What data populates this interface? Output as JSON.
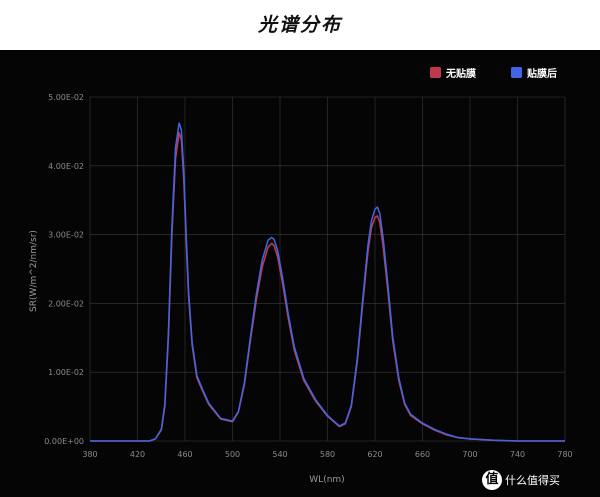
{
  "title": "光谱分布",
  "watermark": {
    "logo_glyph": "值",
    "text": "什么值得买"
  },
  "chart_data": {
    "type": "line",
    "xlabel": "WL(nm)",
    "ylabel": "SR(W/m^2/nm/sr)",
    "xlim": [
      380,
      780
    ],
    "ylim": [
      0,
      0.05
    ],
    "xticks": [
      380,
      420,
      460,
      500,
      540,
      580,
      620,
      660,
      700,
      740,
      780
    ],
    "yticks": [
      0,
      0.01,
      0.02,
      0.03,
      0.04,
      0.05
    ],
    "ytick_labels": [
      "0.00E+00",
      "1.00E-02",
      "2.00E-02",
      "3.00E-02",
      "4.00E-02",
      "5.00E-02"
    ],
    "grid": true,
    "legend_position": "top-right",
    "series": [
      {
        "name": "无贴膜",
        "color": "#c0394a",
        "x": [
          380,
          430,
          435,
          440,
          443,
          446,
          449,
          452,
          455,
          457,
          459,
          461,
          463,
          466,
          470,
          475,
          480,
          490,
          500,
          505,
          510,
          515,
          520,
          525,
          530,
          533,
          535,
          538,
          542,
          547,
          552,
          560,
          570,
          580,
          590,
          595,
          600,
          605,
          610,
          614,
          617,
          620,
          622,
          624,
          627,
          631,
          635,
          640,
          645,
          650,
          660,
          670,
          680,
          690,
          700,
          720,
          740,
          760,
          780
        ],
        "y": [
          0,
          0,
          0.0003,
          0.0016,
          0.005,
          0.015,
          0.03,
          0.041,
          0.0448,
          0.0438,
          0.038,
          0.029,
          0.021,
          0.014,
          0.0092,
          0.0072,
          0.0053,
          0.0032,
          0.0028,
          0.0042,
          0.0082,
          0.0145,
          0.0205,
          0.0253,
          0.0282,
          0.0287,
          0.0284,
          0.0268,
          0.0231,
          0.0178,
          0.0132,
          0.0088,
          0.0058,
          0.0036,
          0.0021,
          0.0025,
          0.005,
          0.0115,
          0.0205,
          0.0275,
          0.031,
          0.0325,
          0.0327,
          0.0318,
          0.0281,
          0.0215,
          0.0145,
          0.0088,
          0.0053,
          0.0037,
          0.0025,
          0.0016,
          0.0009,
          0.0005,
          0.0003,
          0.0001,
          0,
          0,
          0
        ]
      },
      {
        "name": "贴膜后",
        "color": "#3e66e6",
        "x": [
          380,
          430,
          435,
          440,
          443,
          446,
          449,
          452,
          455,
          457,
          459,
          461,
          463,
          466,
          470,
          475,
          480,
          490,
          500,
          505,
          510,
          515,
          520,
          525,
          530,
          533,
          535,
          538,
          542,
          547,
          552,
          560,
          570,
          580,
          590,
          595,
          600,
          605,
          610,
          614,
          617,
          620,
          622,
          624,
          627,
          631,
          635,
          640,
          645,
          650,
          660,
          670,
          680,
          690,
          700,
          720,
          740,
          760,
          780
        ],
        "y": [
          0,
          0,
          0.0003,
          0.0017,
          0.0053,
          0.0157,
          0.0312,
          0.0426,
          0.0462,
          0.0452,
          0.0392,
          0.03,
          0.0217,
          0.0144,
          0.0095,
          0.0074,
          0.0055,
          0.0033,
          0.0029,
          0.0043,
          0.0085,
          0.015,
          0.0213,
          0.0263,
          0.0292,
          0.0296,
          0.0293,
          0.0277,
          0.0239,
          0.0184,
          0.0137,
          0.0091,
          0.006,
          0.0037,
          0.0022,
          0.0026,
          0.0052,
          0.0119,
          0.0212,
          0.0284,
          0.032,
          0.0337,
          0.034,
          0.0331,
          0.0293,
          0.0224,
          0.0151,
          0.0092,
          0.0055,
          0.0039,
          0.0026,
          0.0017,
          0.001,
          0.0005,
          0.0003,
          0.0001,
          0,
          0,
          0
        ]
      }
    ]
  }
}
